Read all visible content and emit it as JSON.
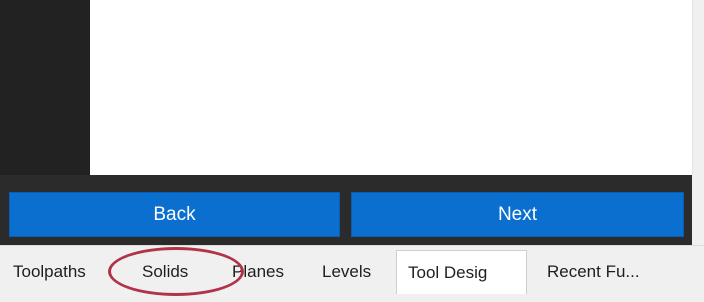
{
  "buttons": {
    "back_label": "Back",
    "next_label": "Next"
  },
  "tabs": [
    {
      "label": "Toolpaths",
      "active": false
    },
    {
      "label": "Solids",
      "active": false
    },
    {
      "label": "Planes",
      "active": false
    },
    {
      "label": "Levels",
      "active": false
    },
    {
      "label": "Tool Desig",
      "active": true
    },
    {
      "label": "Recent Fu...",
      "active": false
    }
  ],
  "colors": {
    "button_blue": "#0a6fce",
    "button_bar": "#2b2b2b",
    "left_panel": "#222222",
    "annotation": "#b0334a"
  }
}
